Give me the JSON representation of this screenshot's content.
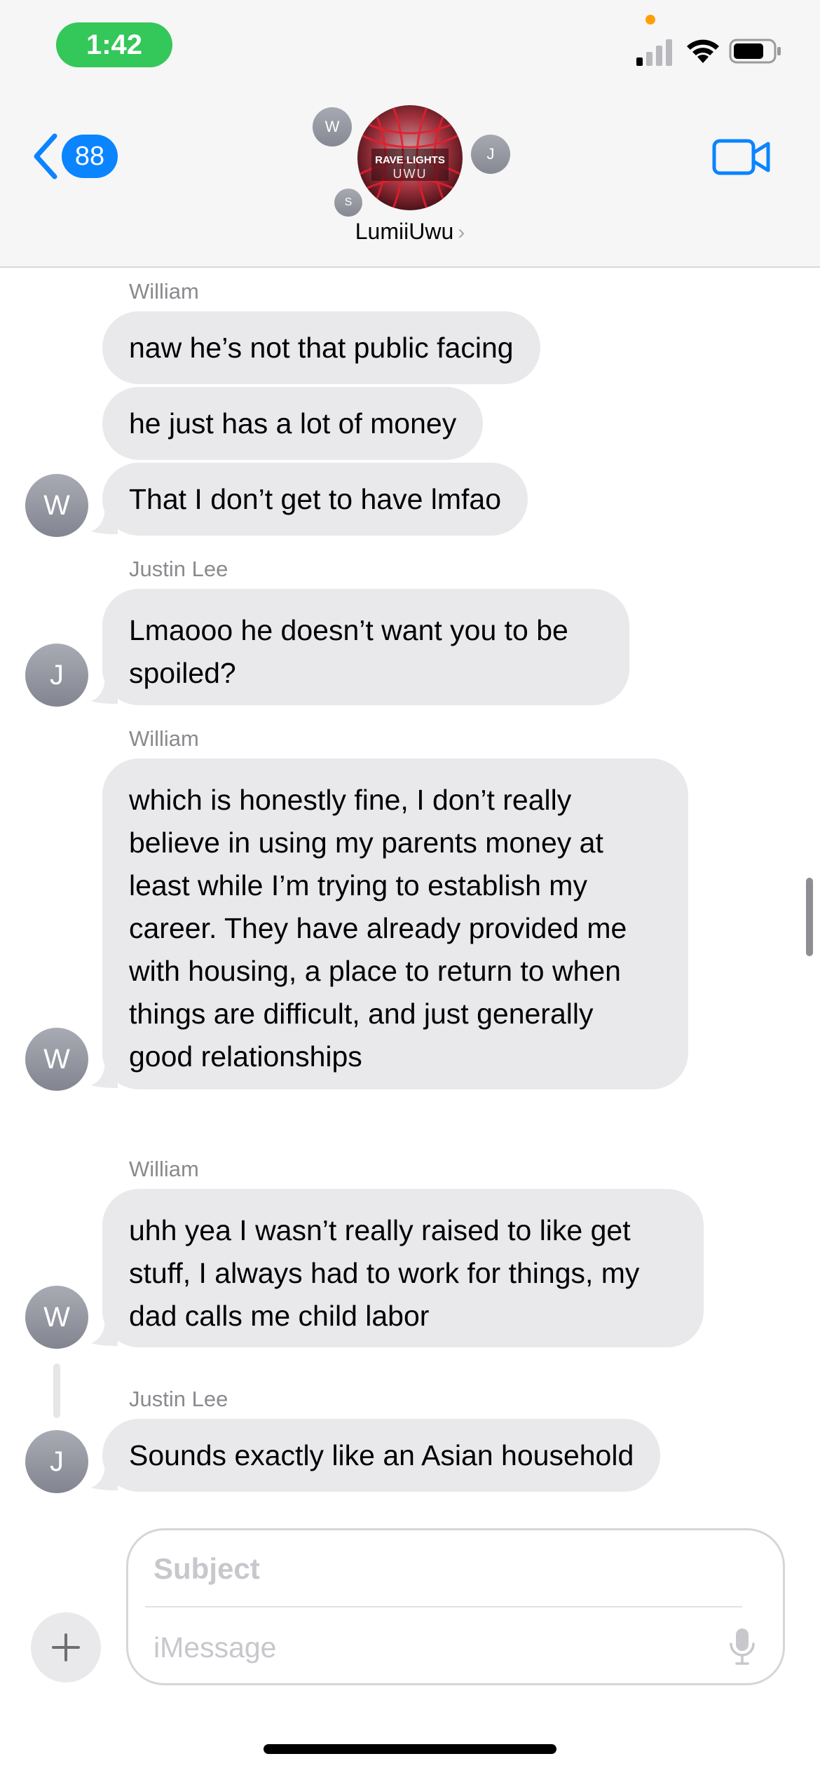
{
  "status_bar": {
    "time": "1:42",
    "icons": [
      "cellular-signal-icon",
      "wifi-icon",
      "battery-icon"
    ]
  },
  "header": {
    "back_count": "88",
    "group_name": "LumiiUwu",
    "group_image_text_line1": "RAVE LIGHTS",
    "group_image_text_line2": "UWU",
    "participant_initials": [
      "W",
      "J",
      "S"
    ]
  },
  "messages": [
    {
      "sender": "William",
      "initial": "W",
      "bubbles": [
        "naw he’s not that public facing",
        "he just has a lot of money",
        "That I don’t get to have lmfao"
      ]
    },
    {
      "sender": "Justin Lee",
      "initial": "J",
      "bubbles": [
        "Lmaooo he doesn’t want you to be spoiled?"
      ]
    },
    {
      "sender": "William",
      "initial": "W",
      "bubbles": [
        "which is honestly fine, I don’t really believe in using my parents money at least while I’m trying to establish my career. They have already provided me with housing, a place to return to when things are difficult, and just generally good relationships"
      ]
    },
    {
      "sender": "William",
      "initial": "W",
      "bubbles": [
        "uhh yea I wasn’t really raised to like get stuff, I always had to work for things, my dad calls me child labor"
      ]
    },
    {
      "sender": "Justin Lee",
      "initial": "J",
      "bubbles": [
        "Sounds exactly like an Asian household"
      ]
    }
  ],
  "compose": {
    "subject_placeholder": "Subject",
    "message_placeholder": "iMessage"
  },
  "colors": {
    "accent": "#0a84ff",
    "bubble_incoming": "#e9e9eb",
    "time_pill": "#34c759"
  }
}
